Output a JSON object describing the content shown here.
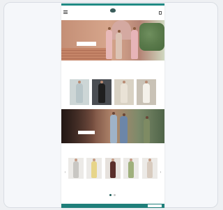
{
  "colors": {
    "accent": "#1f8a84",
    "footer": "#1f7f7a"
  },
  "header": {
    "menu_icon": "menu-icon",
    "logo_text": "",
    "bag_icon": "bag-icon"
  },
  "hero": {
    "title": "",
    "subtitle": "",
    "button_label": ""
  },
  "categories_section": {
    "title": "",
    "subtitle": "",
    "items": [
      {
        "label": "",
        "dress_color": "#b8c6c9"
      },
      {
        "label": "",
        "dress_color": "#1f1f1f"
      },
      {
        "label": "",
        "dress_color": "#e9e2d6"
      },
      {
        "label": "",
        "dress_color": "#f4f1ea"
      }
    ]
  },
  "banner": {
    "year": "",
    "subtitle": "",
    "button_label": ""
  },
  "products_section": {
    "title": "",
    "items": [
      {
        "name": "",
        "price": "",
        "dress_color": "#c9c7c3"
      },
      {
        "name": "",
        "price": "",
        "dress_color": "#e7d58a"
      },
      {
        "name": "",
        "price": "",
        "dress_color": "#c97e6f"
      },
      {
        "name": "",
        "price": "",
        "dress_color": "#5a2e2a"
      },
      {
        "name": "",
        "price": "",
        "dress_color": "#9fb07c"
      },
      {
        "name": "",
        "price": "",
        "dress_color": "#d8cbbf"
      }
    ]
  },
  "carousel": {
    "active_dot": 1,
    "dot_count": 2
  },
  "footer": {
    "text": "",
    "button_label": ""
  }
}
